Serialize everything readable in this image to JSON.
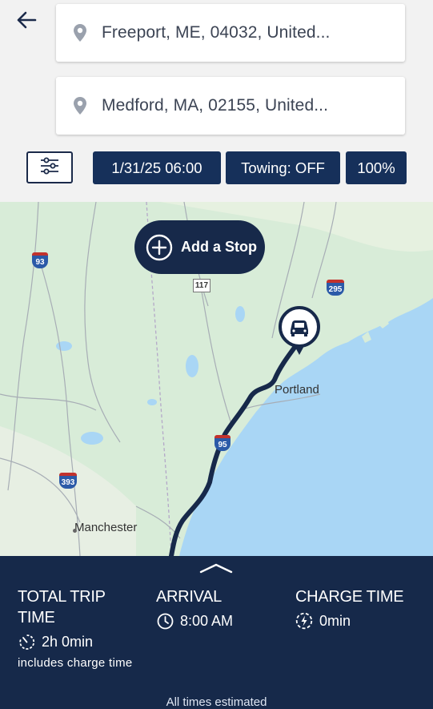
{
  "top": {
    "origin": "Freeport, ME, 04032, United...",
    "destination": "Medford, MA, 02155, United...",
    "chips": {
      "datetime": "1/31/25 06:00",
      "towing": "Towing: OFF",
      "charge": "100%"
    }
  },
  "icons": {
    "back": "back-arrow-icon",
    "pin": "location-pin-icon",
    "settings": "sliders-icon",
    "add": "plus-circle-icon",
    "car": "car-marker-icon",
    "timer": "timer-icon",
    "clock": "clock-icon",
    "charge": "charge-bolt-icon"
  },
  "map": {
    "add_stop_label": "Add a Stop",
    "labels": {
      "portland": "Portland",
      "manchester": "Manchester"
    },
    "shields": {
      "i93": "93",
      "r117": "117",
      "i295": "295",
      "i95": "95",
      "i393": "393"
    },
    "colors": {
      "land": "#d8ecd8",
      "water": "#a9d6f5",
      "route": "#17294a"
    }
  },
  "summary": {
    "total_trip_time": {
      "heading": "TOTAL TRIP TIME",
      "value": "2h 0min",
      "note": "includes charge time"
    },
    "arrival": {
      "heading": "ARRIVAL",
      "value": "8:00 AM"
    },
    "charge_time": {
      "heading": "CHARGE TIME",
      "value": "0min"
    },
    "footer": "All times estimated"
  }
}
